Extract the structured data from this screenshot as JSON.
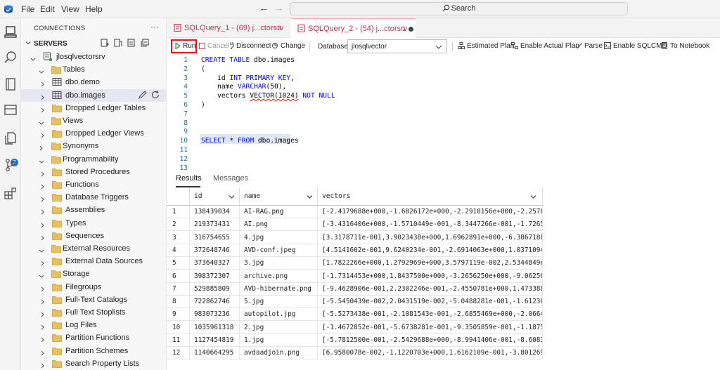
{
  "menu": {
    "file": "File",
    "edit": "Edit",
    "view": "View",
    "help": "Help"
  },
  "search": {
    "label": "Search"
  },
  "activity": {
    "badge": "2"
  },
  "sidebar": {
    "header": "CONNECTIONS",
    "more": "···",
    "servers_label": "SERVERS",
    "tree": [
      {
        "label": "jlosqlvectorsrv",
        "icon": "server",
        "indent": 0
      },
      {
        "label": "Tables",
        "icon": "folder",
        "indent": 1
      },
      {
        "label": "dbo.demo",
        "icon": "table",
        "indent": 2
      },
      {
        "label": "dbo.images",
        "icon": "table",
        "indent": 2,
        "selected": true
      },
      {
        "label": "Dropped Ledger Tables",
        "icon": "folder",
        "indent": 2
      },
      {
        "label": "Views",
        "icon": "folder",
        "indent": 1
      },
      {
        "label": "Dropped Ledger Views",
        "icon": "folder",
        "indent": 2
      },
      {
        "label": "Synonyms",
        "icon": "folder",
        "indent": 1
      },
      {
        "label": "Programmability",
        "icon": "folder",
        "indent": 1
      },
      {
        "label": "Stored Procedures",
        "icon": "folder",
        "indent": 2
      },
      {
        "label": "Functions",
        "icon": "folder",
        "indent": 2
      },
      {
        "label": "Database Triggers",
        "icon": "folder",
        "indent": 2
      },
      {
        "label": "Assemblies",
        "icon": "folder",
        "indent": 2
      },
      {
        "label": "Types",
        "icon": "folder",
        "indent": 2
      },
      {
        "label": "Sequences",
        "icon": "folder",
        "indent": 2
      },
      {
        "label": "External Resources",
        "icon": "folder",
        "indent": 1
      },
      {
        "label": "External Data Sources",
        "icon": "folder",
        "indent": 2
      },
      {
        "label": "Storage",
        "icon": "folder",
        "indent": 1
      },
      {
        "label": "Filegroups",
        "icon": "folder",
        "indent": 2
      },
      {
        "label": "Full-Text Catalogs",
        "icon": "folder",
        "indent": 2
      },
      {
        "label": "Full Text Stoplists",
        "icon": "folder",
        "indent": 2
      },
      {
        "label": "Log Files",
        "icon": "folder",
        "indent": 2
      },
      {
        "label": "Partition Functions",
        "icon": "folder",
        "indent": 2
      },
      {
        "label": "Partition Schemes",
        "icon": "folder",
        "indent": 2
      },
      {
        "label": "Search Property Lists",
        "icon": "folder",
        "indent": 2
      }
    ]
  },
  "tabs": [
    {
      "title": "SQLQuery_1 - (69) j...ctorsrv",
      "count": "3"
    },
    {
      "title": "SQLQuery_2 - (54) j...ctorsrv",
      "count": "1"
    }
  ],
  "toolbar": {
    "run": "Run",
    "cancel": "Cancel",
    "disconnect": "Disconnect",
    "change": "Change",
    "database_label": "Database:",
    "database_value": "jlosqlvector",
    "estimated_plan": "Estimated Plan",
    "actual_plan": "Enable Actual Plan",
    "parse": "Parse",
    "sqlcmd": "Enable SQLCMD",
    "notebook": "To Notebook"
  },
  "editor": {
    "lines": [
      {
        "n": "1",
        "parts": [
          [
            "kw",
            "CREATE TABLE "
          ],
          [
            "",
            "dbo.images"
          ]
        ]
      },
      {
        "n": "2",
        "parts": [
          [
            "",
            "("
          ]
        ]
      },
      {
        "n": "3",
        "parts": [
          [
            "",
            "    id "
          ],
          [
            "kw",
            "INT PRIMARY KEY"
          ],
          [
            "",
            ","
          ]
        ]
      },
      {
        "n": "4",
        "parts": [
          [
            "",
            "    name "
          ],
          [
            "kw",
            "VARCHAR"
          ],
          [
            "",
            "(50),"
          ]
        ]
      },
      {
        "n": "5",
        "parts": [
          [
            "",
            "    vectors "
          ],
          [
            "squig",
            "VECTOR(1024)"
          ],
          [
            "",
            " "
          ],
          [
            "kw",
            "NOT NULL"
          ]
        ]
      },
      {
        "n": "6",
        "parts": [
          [
            "",
            ")"
          ]
        ]
      },
      {
        "n": "7",
        "parts": []
      },
      {
        "n": "8",
        "parts": []
      },
      {
        "n": "9",
        "parts": []
      },
      {
        "n": "10",
        "parts": [
          [
            "kw",
            "SELECT "
          ],
          [
            "",
            "* "
          ],
          [
            "kw",
            "FROM "
          ],
          [
            "",
            "dbo.images"
          ]
        ]
      },
      {
        "n": "11",
        "parts": []
      },
      {
        "n": "12",
        "parts": []
      },
      {
        "n": "13",
        "parts": []
      }
    ]
  },
  "results": {
    "tab_results": "Results",
    "tab_messages": "Messages",
    "columns": [
      "id",
      "name",
      "vectors"
    ],
    "rows": [
      [
        "1",
        "138439034",
        "AI-RAG.png",
        "[-2.4179688e+000,-1.6826172e+000,-2.2910156e+000,-2.25781"
      ],
      [
        "2",
        "219373431",
        "AI.png",
        "[-3.4316406e+000,-1.5710449e-001,-8.3447266e-001,-1.72656"
      ],
      [
        "3",
        "316754655",
        "4.jpg",
        "[3.3178711e-001,3.9023438e+000,1.6962891e+000,-6.3867188e"
      ],
      [
        "4",
        "372648746",
        "AVD-conf.jpeg",
        "[4.5141602e-001,9.6240234e-001,-2.6914063e+000,1.0371094e"
      ],
      [
        "5",
        "373640327",
        "3.jpg",
        "[1.7822266e+000,1.2792969e+000,3.5797119e-002,2.5344849e-"
      ],
      [
        "6",
        "398372307",
        "archive.png",
        "[-1.7314453e+000,1.8437500e+000,-3.2656250e+000,-9.062500"
      ],
      [
        "7",
        "529885809",
        "AVD-hibernate.png",
        "[-9.4628906e-001,2.2302246e-001,-2.4550781e+000,1.4733887"
      ],
      [
        "8",
        "722862746",
        "5.jpg",
        "[-5.5450439e-002,2.0431519e-002,-5.0488281e-001,-1.612304"
      ],
      [
        "9",
        "983073236",
        "autopilot.jpg",
        "[-5.5273438e-001,-2.1081543e-001,-2.6855469e+000,-2.06640"
      ],
      [
        "10",
        "1035961318",
        "2.jpg",
        "[-1.4672852e-001,-5.6738281e-001,-9.3505859e-001,-1.18750"
      ],
      [
        "11",
        "1127454819",
        "1.jpg",
        "[-5.7812500e-001,-2.5429688e+000,-8.9941406e-001,-8.60839"
      ],
      [
        "12",
        "1140664295",
        "avdaadjoin.png",
        "[6.9580078e-002,-1.1220703e+000,1.6162109e-001,-3.8012695"
      ]
    ]
  }
}
